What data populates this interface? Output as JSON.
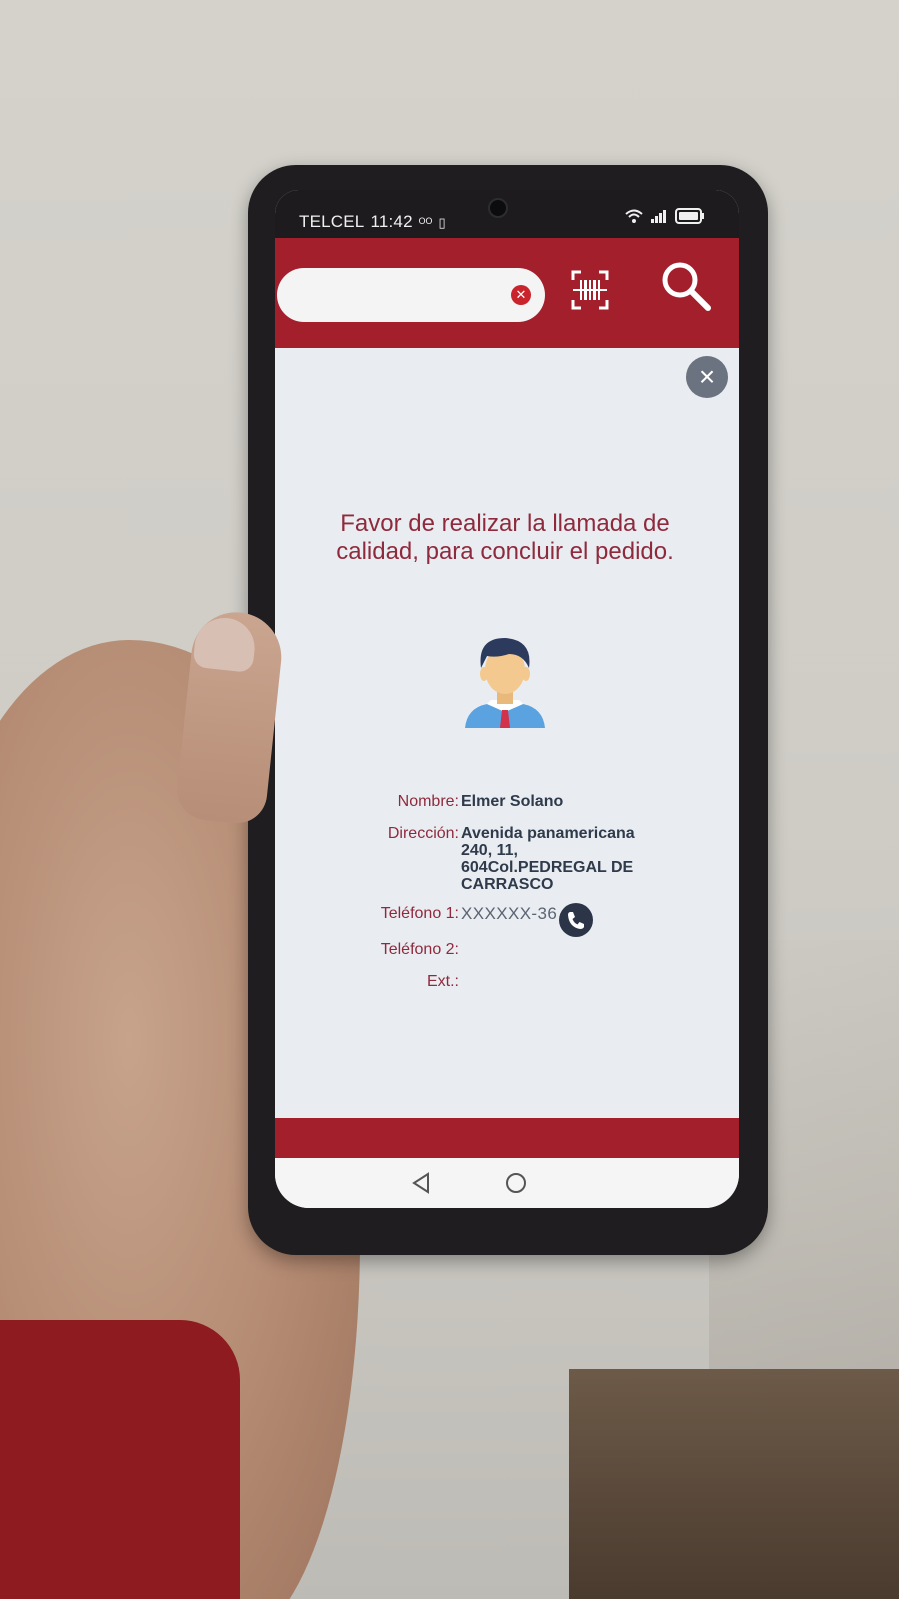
{
  "status_bar": {
    "carrier": "TELCEL",
    "time": "11:42"
  },
  "search": {
    "value": "",
    "placeholder": ""
  },
  "icons": {
    "barcode": "barcode-scan-icon",
    "search": "magnifier-icon",
    "close": "close-icon",
    "phone": "phone-icon"
  },
  "modal": {
    "message": "Favor de realizar la llamada de calidad, para concluir el pedido.",
    "fields": {
      "nombre_label": "Nombre:",
      "nombre_value": "Elmer Solano",
      "direccion_label": "Dirección:",
      "direccion_value": "Avenida panamericana 240, 11, 604Col.PEDREGAL DE CARRASCO",
      "telefono1_label": "Teléfono 1:",
      "telefono1_value": "XXXXXX-36",
      "telefono2_label": "Teléfono 2:",
      "telefono2_value": "",
      "ext_label": "Ext.:",
      "ext_value": ""
    }
  },
  "colors": {
    "brand_red": "#a31f2b",
    "label_text": "#8f2a3c",
    "value_text": "#2f3a4b",
    "screen_background": "#e9edf2"
  }
}
